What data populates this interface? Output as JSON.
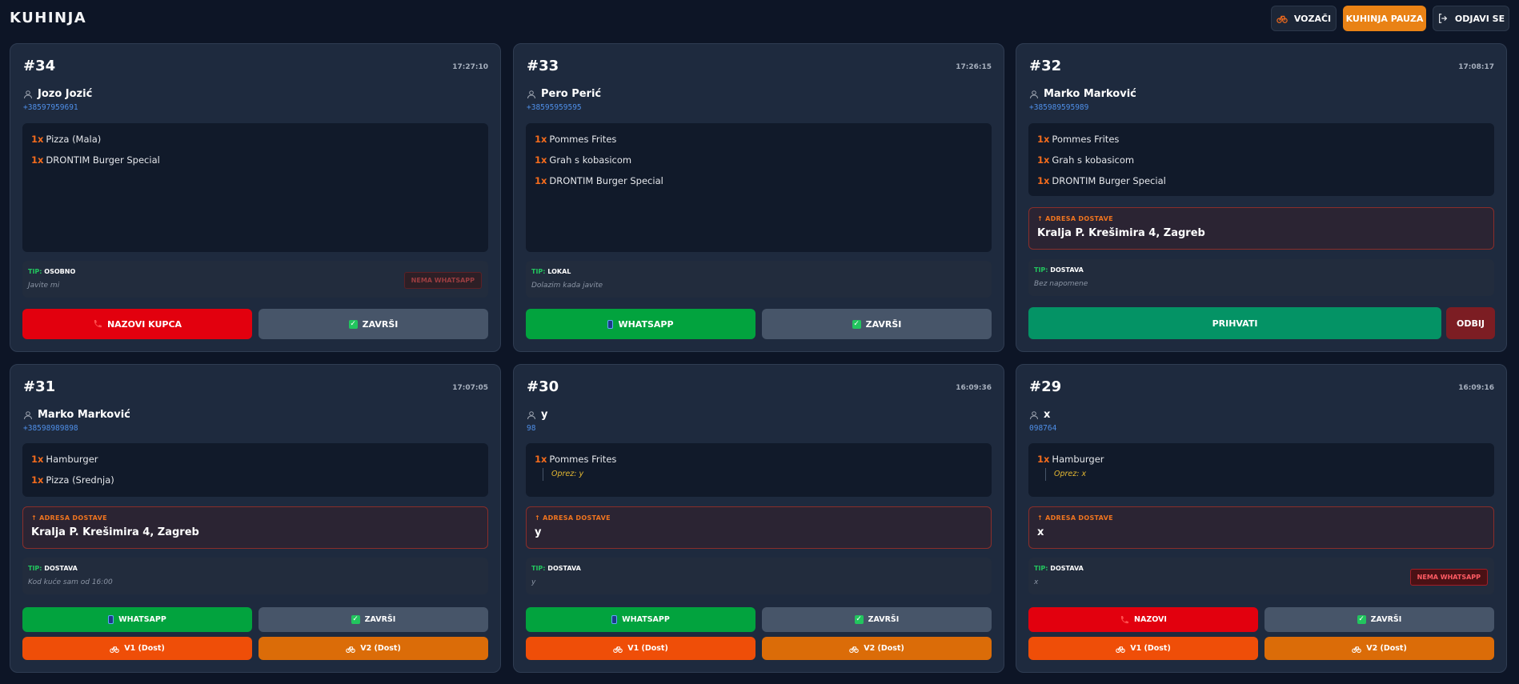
{
  "header": {
    "title": "KUHINJA",
    "drivers_label": "VOZAČI",
    "pause_label": "KUHINJA PAUZA",
    "logout_label": "ODJAVI SE"
  },
  "colors": {
    "accent": "#e98215",
    "call": "#e2000e",
    "whatsapp": "#02a33e",
    "accept": "#049365",
    "v1": "#ef4e08",
    "v2": "#db6c08"
  },
  "tip_key": "TIP:",
  "address_label": "ADRESA DOSTAVE",
  "orders": [
    {
      "number": "#34",
      "time": "17:27:10",
      "customer": "Jozo Jozić",
      "phone": "+38597959691",
      "items": [
        {
          "qty": "1x",
          "name": "Pizza (Mala)"
        },
        {
          "qty": "1x",
          "name": "DRONTIM Burger Special"
        }
      ],
      "type": "OSOBNO",
      "note": "Javite mi",
      "badge": "NEMA WHATSAPP",
      "buttons": [
        "NAZOVI KUPCA",
        "ZAVRŠI"
      ]
    },
    {
      "number": "#33",
      "time": "17:26:15",
      "customer": "Pero Perić",
      "phone": "+38595959595",
      "items": [
        {
          "qty": "1x",
          "name": "Pommes Frites"
        },
        {
          "qty": "1x",
          "name": "Grah s kobasicom"
        },
        {
          "qty": "1x",
          "name": "DRONTIM Burger Special"
        }
      ],
      "type": "LOKAL",
      "note": "Dolazim kada javite",
      "buttons": [
        "WHATSAPP",
        "ZAVRŠI"
      ]
    },
    {
      "number": "#32",
      "time": "17:08:17",
      "customer": "Marko Marković",
      "phone": "+385989595989",
      "items": [
        {
          "qty": "1x",
          "name": "Pommes Frites"
        },
        {
          "qty": "1x",
          "name": "Grah s kobasicom"
        },
        {
          "qty": "1x",
          "name": "DRONTIM Burger Special"
        }
      ],
      "address": "Kralja P. Krešimira 4, Zagreb",
      "type": "DOSTAVA",
      "note": "Bez napomene",
      "buttons": [
        "PRIHVATI",
        "ODBIJ"
      ]
    },
    {
      "number": "#31",
      "time": "17:07:05",
      "customer": "Marko Marković",
      "phone": "+38598989898",
      "items": [
        {
          "qty": "1x",
          "name": "Hamburger"
        },
        {
          "qty": "1x",
          "name": "Pizza (Srednja)"
        }
      ],
      "address": "Kralja P. Krešimira 4, Zagreb",
      "type": "DOSTAVA",
      "note": "Kod kuće sam od 16:00",
      "buttons": [
        "WHATSAPP",
        "ZAVRŠI",
        "V1 (Dost)",
        "V2 (Dost)"
      ]
    },
    {
      "number": "#30",
      "time": "16:09:36",
      "customer": "y",
      "phone": "98",
      "items": [
        {
          "qty": "1x",
          "name": "Pommes Frites",
          "note": "Oprez: y"
        }
      ],
      "address": "y",
      "type": "DOSTAVA",
      "note": "y",
      "buttons": [
        "WHATSAPP",
        "ZAVRŠI",
        "V1 (Dost)",
        "V2 (Dost)"
      ]
    },
    {
      "number": "#29",
      "time": "16:09:16",
      "customer": "x",
      "phone": "098764",
      "items": [
        {
          "qty": "1x",
          "name": "Hamburger",
          "note": "Oprez: x"
        }
      ],
      "address": "x",
      "type": "DOSTAVA",
      "note": "x",
      "badge": "NEMA WHATSAPP",
      "buttons": [
        "NAZOVI",
        "ZAVRŠI",
        "V1 (Dost)",
        "V2 (Dost)"
      ]
    }
  ]
}
